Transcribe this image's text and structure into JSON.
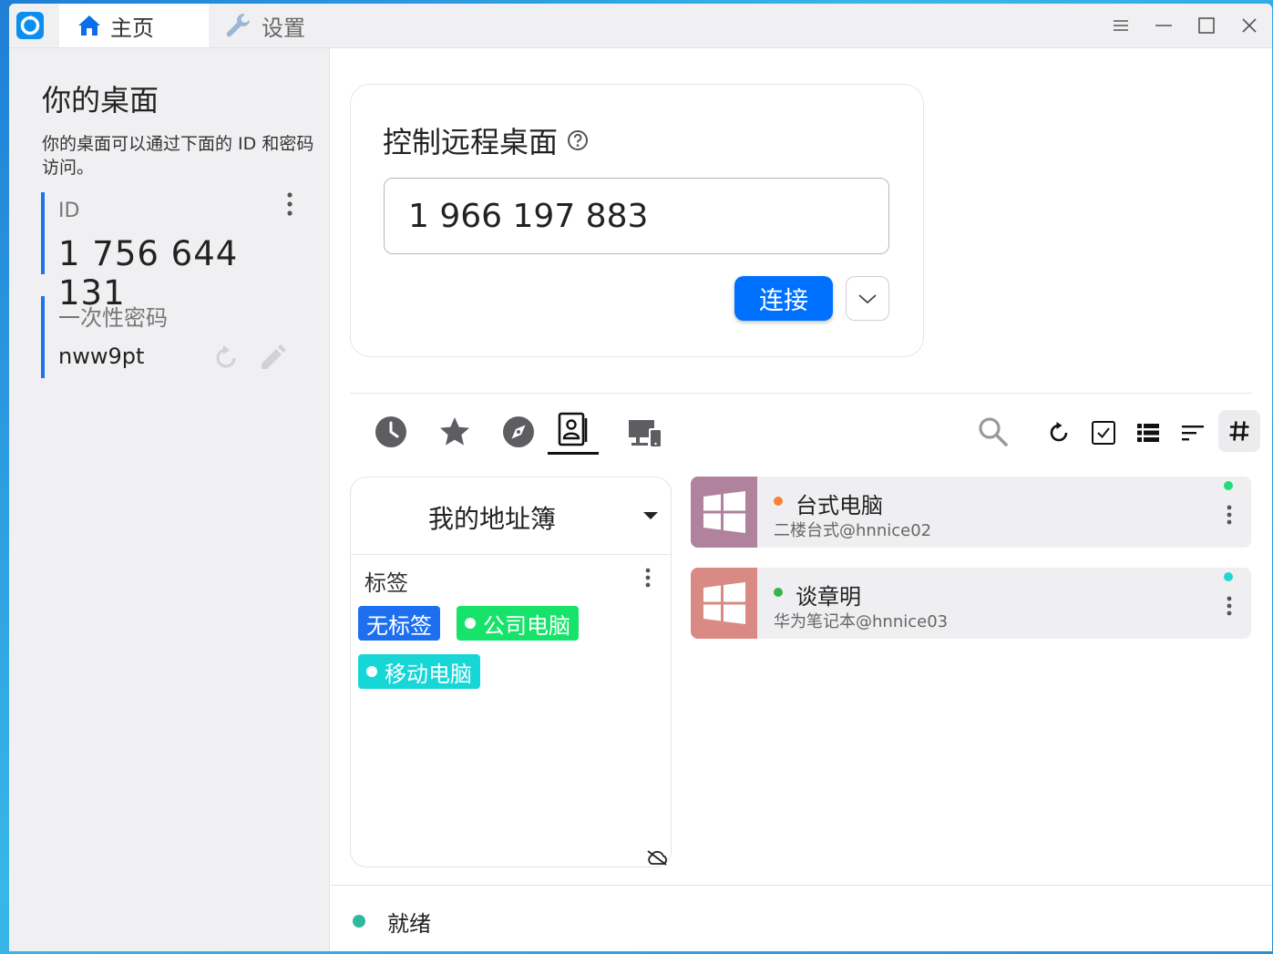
{
  "titlebar": {
    "tabs": [
      {
        "label": "主页",
        "icon": "home-icon",
        "active": true
      },
      {
        "label": "设置",
        "icon": "wrench-icon",
        "active": false
      }
    ]
  },
  "left": {
    "title": "你的桌面",
    "description": "你的桌面可以通过下面的 ID 和密码访问。",
    "id_label": "ID",
    "id_value": "1 756 644 131",
    "password_label": "一次性密码",
    "password_value": "nww9pt"
  },
  "control": {
    "title": "控制远程桌面",
    "remote_id": "1 966 197 883",
    "connect_label": "连接"
  },
  "address_book": {
    "title": "我的地址簿",
    "tags_label": "标签",
    "tags": [
      {
        "label": "无标签",
        "color": "#1e6ff0",
        "dot": false
      },
      {
        "label": "公司电脑",
        "color": "#17e36a",
        "dot": true
      },
      {
        "label": "移动电脑",
        "color": "#17d6d6",
        "dot": true
      }
    ]
  },
  "peers": [
    {
      "name": "台式电脑",
      "subtitle": "二楼台式@hnnice02",
      "status_color": "#f5823a",
      "online_color": "#22dd77",
      "os_color": "#b0829e"
    },
    {
      "name": "谈章明",
      "subtitle": "华为笔记本@hnnice03",
      "status_color": "#3ab44a",
      "online_color": "#22d6d6",
      "os_color": "#d98a84"
    }
  ],
  "statusbar": {
    "text": "就绪",
    "color": "#2fb8a0"
  }
}
